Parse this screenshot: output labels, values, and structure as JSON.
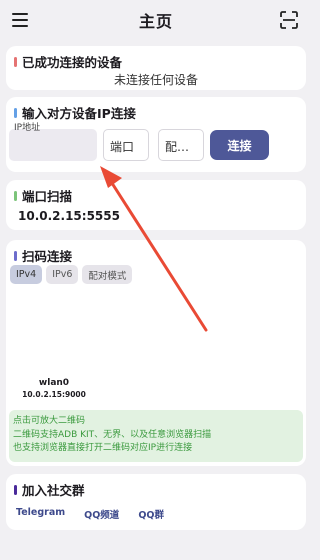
{
  "appbar": {
    "title": "主页"
  },
  "devices": {
    "title": "已成功连接的设备",
    "empty_text": "未连接任何设备",
    "accent": "#e57373"
  },
  "ip_connect": {
    "title": "输入对方设备IP连接",
    "ip_label": "IP地址",
    "ip_value": "",
    "port_placeholder": "端口",
    "pair_placeholder": "配…",
    "connect_label": "连接",
    "accent": "#64a0e6"
  },
  "port_scan": {
    "title": "端口扫描",
    "address": "10.0.2.15:5555",
    "accent": "#7cc47a"
  },
  "qr": {
    "title": "扫码连接",
    "accent": "#6d6dcc",
    "chips": [
      "IPv4",
      "IPv6",
      "配对模式"
    ],
    "iface": "wlan0",
    "iface_addr": "10.0.2.15:9000",
    "tips": [
      "点击可放大二维码",
      "二维码支持ADB KIT、无界、以及任意浏览器扫描",
      "也支持浏览器直接打开二维码对应IP进行连接"
    ]
  },
  "social": {
    "title": "加入社交群",
    "accent": "#4a2a9a",
    "links": [
      "Telegram",
      "QQ频道",
      "QQ群"
    ]
  }
}
